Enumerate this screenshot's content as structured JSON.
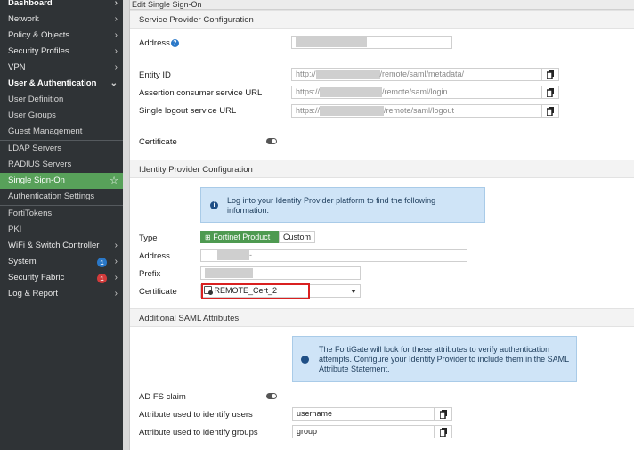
{
  "sidebar": {
    "items": [
      {
        "label": "Dashboard",
        "chevron": "chevron-right-icon"
      },
      {
        "label": "Network",
        "chevron": "chevron-right-icon"
      },
      {
        "label": "Policy & Objects",
        "chevron": "chevron-right-icon"
      },
      {
        "label": "Security Profiles",
        "chevron": "chevron-right-icon"
      },
      {
        "label": "VPN",
        "chevron": "chevron-right-icon"
      },
      {
        "label": "User & Authentication",
        "chevron": "chevron-down-icon"
      },
      {
        "label": "User Definition"
      },
      {
        "label": "User Groups"
      },
      {
        "label": "Guest Management"
      },
      {
        "label": "LDAP Servers"
      },
      {
        "label": "RADIUS Servers"
      },
      {
        "label": "Single Sign-On",
        "active": true
      },
      {
        "label": "Authentication Settings"
      },
      {
        "label": "FortiTokens"
      },
      {
        "label": "PKI"
      },
      {
        "label": "WiFi & Switch Controller",
        "chevron": "chevron-right-icon"
      },
      {
        "label": "System",
        "badge": "1",
        "badge_color": "#2a78c8",
        "chevron": "chevron-right-icon"
      },
      {
        "label": "Security Fabric",
        "badge": "1",
        "badge_color": "#d23b3b",
        "chevron": "chevron-right-icon"
      },
      {
        "label": "Log & Report",
        "chevron": "chevron-right-icon"
      }
    ]
  },
  "page": {
    "title": "Edit Single Sign-On"
  },
  "sp": {
    "heading": "Service Provider Configuration",
    "address_label": "Address",
    "entity_label": "Entity ID",
    "entity_prefix": "http://",
    "entity_suffix": "/remote/saml/metadata/",
    "acs_label": "Assertion consumer service URL",
    "acs_prefix": "https://",
    "acs_suffix": "/remote/saml/login",
    "slo_label": "Single logout service URL",
    "slo_prefix": "https://",
    "slo_suffix": "/remote/saml/logout",
    "cert_label": "Certificate"
  },
  "idp": {
    "heading": "Identity Provider Configuration",
    "info": "Log into your Identity Provider platform to find the following information.",
    "type_label": "Type",
    "type_options": [
      "Fortinet Product",
      "Custom"
    ],
    "type_selected": "Fortinet Product",
    "address_label": "Address",
    "address_suffix": "-",
    "prefix_label": "Prefix",
    "cert_label": "Certificate",
    "cert_value": "REMOTE_Cert_2"
  },
  "saml": {
    "heading": "Additional SAML Attributes",
    "info": "The FortiGate will look for these attributes to verify authentication attempts. Configure your Identity Provider to include them in the SAML Attribute Statement.",
    "adfs_label": "AD FS claim",
    "users_label": "Attribute used to identify users",
    "users_value": "username",
    "groups_label": "Attribute used to identify groups",
    "groups_value": "group"
  },
  "colors": {
    "accent": "#58a15a",
    "sidebar": "#2f3336",
    "highlight": "#d92020",
    "info_bg": "#cfe4f7"
  }
}
